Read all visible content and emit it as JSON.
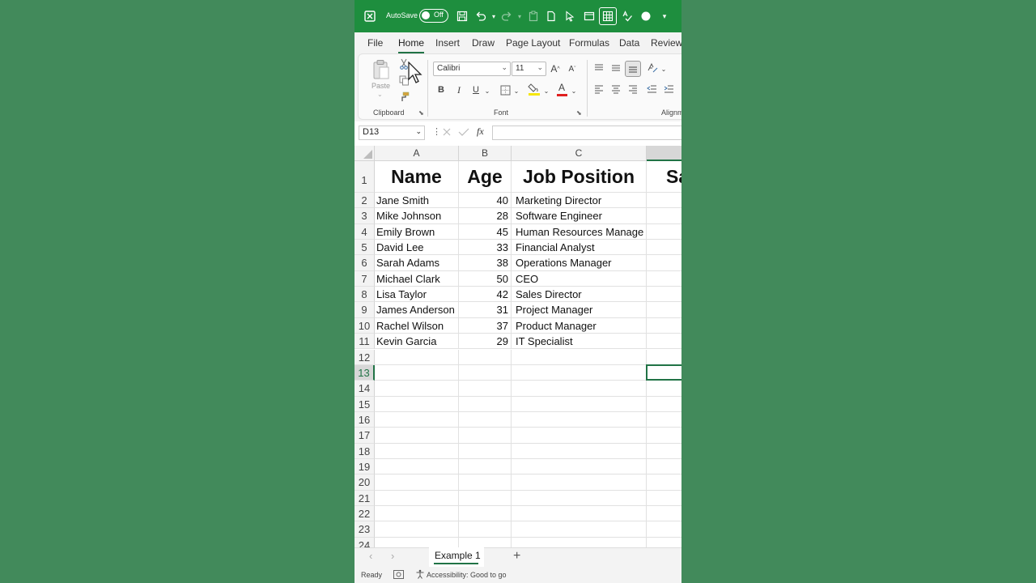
{
  "titlebar": {
    "autosave_label": "AutoSave",
    "autosave_state": "Off",
    "icons": [
      "excel-logo-icon",
      "save-icon",
      "undo-icon",
      "redo-icon",
      "clipboard-icon",
      "new-file-icon",
      "pointer-icon",
      "window-icon",
      "table-icon",
      "spellcheck-icon",
      "record-icon",
      "customize-icon"
    ]
  },
  "tabs": [
    "File",
    "Home",
    "Insert",
    "Draw",
    "Page Layout",
    "Formulas",
    "Data",
    "Review"
  ],
  "active_tab": "Home",
  "ribbon": {
    "clipboard": {
      "paste_label": "Paste",
      "group_label": "Clipboard"
    },
    "font": {
      "font_name": "Calibri",
      "font_size": "11",
      "group_label": "Font",
      "bold": "B",
      "italic": "I",
      "underline": "U",
      "grow": "A",
      "shrink": "A",
      "font_color_letter": "A"
    },
    "alignment": {
      "group_label": "Alignm"
    }
  },
  "formula_bar": {
    "name_box": "D13",
    "fx": "fx",
    "value": ""
  },
  "columns": [
    "A",
    "B",
    "C",
    ""
  ],
  "rows": [
    "1",
    "2",
    "3",
    "4",
    "5",
    "6",
    "7",
    "8",
    "9",
    "10",
    "11",
    "12",
    "13",
    "14",
    "15",
    "16",
    "17",
    "18",
    "19",
    "20",
    "21",
    "22",
    "23",
    "24"
  ],
  "headers": {
    "name": "Name",
    "age": "Age",
    "job": "Job Position",
    "salary": "Sa"
  },
  "data": [
    {
      "name": "Jane Smith",
      "age": "40",
      "job": "Marketing Director"
    },
    {
      "name": "Mike Johnson",
      "age": "28",
      "job": "Software Engineer"
    },
    {
      "name": "Emily Brown",
      "age": "45",
      "job": "Human Resources Manage"
    },
    {
      "name": "David Lee",
      "age": "33",
      "job": "Financial Analyst"
    },
    {
      "name": "Sarah Adams",
      "age": "38",
      "job": "Operations Manager"
    },
    {
      "name": "Michael Clark",
      "age": "50",
      "job": "CEO"
    },
    {
      "name": "Lisa Taylor",
      "age": "42",
      "job": "Sales Director"
    },
    {
      "name": "James Anderson",
      "age": "31",
      "job": "Project Manager"
    },
    {
      "name": "Rachel Wilson",
      "age": "37",
      "job": "Product Manager"
    },
    {
      "name": "Kevin Garcia",
      "age": "29",
      "job": "IT Specialist"
    }
  ],
  "selected_cell": "D13",
  "sheet_tabs": {
    "active": "Example 1",
    "add": "+"
  },
  "status": {
    "ready": "Ready",
    "accessibility": "Accessibility: Good to go"
  },
  "colors": {
    "titlebar": "#1e8e3e",
    "accent": "#217346",
    "background": "#428a5b"
  }
}
